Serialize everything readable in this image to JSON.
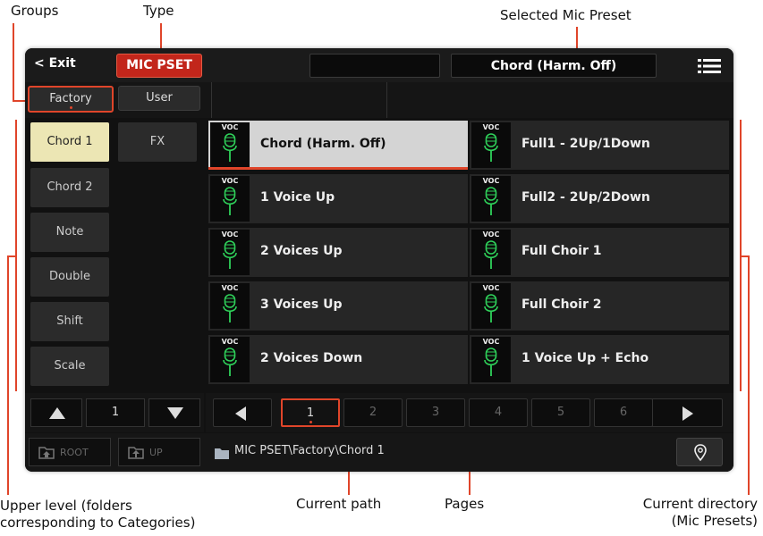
{
  "annotations": {
    "groups": "Groups",
    "type": "Type",
    "selected_mic_preset": "Selected Mic Preset",
    "upper_level_line1": "Upper level (folders",
    "upper_level_line2": "corresponding to Categories)",
    "current_path": "Current path",
    "pages": "Pages",
    "current_directory_line1": "Current directory",
    "current_directory_line2": "(Mic Presets)"
  },
  "header": {
    "exit_label": "< Exit",
    "type_label": "MIC PSET",
    "selected_preset": "Chord (Harm. Off)"
  },
  "groups": {
    "factory": "Factory",
    "user": "User"
  },
  "categories": {
    "left": [
      "Chord 1",
      "Chord 2",
      "Note",
      "Double",
      "Shift",
      "Scale"
    ],
    "right": [
      "FX"
    ],
    "page_number": "1"
  },
  "presets": {
    "icon_label": "VOC",
    "items": [
      "Chord (Harm. Off)",
      "Full1 - 2Up/1Down",
      "1 Voice Up",
      "Full2 - 2Up/2Down",
      "2 Voices Up",
      "Full Choir 1",
      "3 Voices Up",
      "Full Choir 2",
      "2 Voices Down",
      "1 Voice Up + Echo"
    ]
  },
  "pages": [
    "1",
    "2",
    "3",
    "4",
    "5",
    "6"
  ],
  "footer": {
    "root_label": "ROOT",
    "up_label": "UP",
    "path": "MIC PSET\\Factory\\Chord 1"
  },
  "colors": {
    "accent": "#e0452a",
    "type_button": "#c2261b",
    "selected_category": "#ece6b4",
    "mic_icon": "#2fd15a"
  }
}
